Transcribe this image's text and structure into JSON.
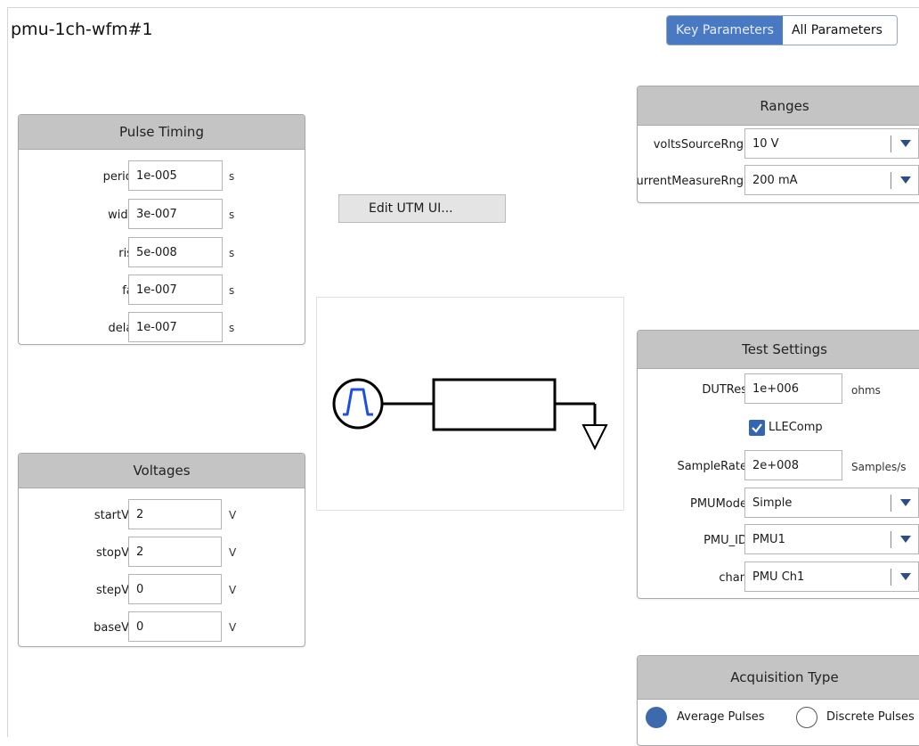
{
  "window_title": "pmu-1ch-wfm#1",
  "view_toggle": {
    "key_parameters": "Key Parameters",
    "all_parameters": "All Parameters",
    "selected": "Key Parameters"
  },
  "edit_button": "Edit UTM UI...",
  "pulse_timing": {
    "title": "Pulse Timing",
    "rows": [
      {
        "label": "period",
        "value": "1e-005",
        "unit": "s"
      },
      {
        "label": "width",
        "value": "3e-007",
        "unit": "s"
      },
      {
        "label": "rise",
        "value": "5e-008",
        "unit": "s"
      },
      {
        "label": "fall",
        "value": "1e-007",
        "unit": "s"
      },
      {
        "label": "delay",
        "value": "1e-007",
        "unit": "s"
      }
    ]
  },
  "voltages": {
    "title": "Voltages",
    "rows": [
      {
        "label": "startV",
        "value": "2",
        "unit": "V"
      },
      {
        "label": "stopV",
        "value": "2",
        "unit": "V"
      },
      {
        "label": "stepV",
        "value": "0",
        "unit": "V"
      },
      {
        "label": "baseV",
        "value": "0",
        "unit": "V"
      }
    ]
  },
  "ranges": {
    "title": "Ranges",
    "volts_label": "voltsSourceRng",
    "volts_value": "10 V",
    "current_label": "urrentMeasureRng",
    "current_value": "200 mA"
  },
  "test_settings": {
    "title": "Test Settings",
    "dutres_label": "DUTRes",
    "dutres_value": "1e+006",
    "dutres_unit": "ohms",
    "llecomp_label": "LLEComp",
    "llecomp_checked": true,
    "samplerate_label": "SampleRate",
    "samplerate_value": "2e+008",
    "samplerate_unit": "Samples/s",
    "pmumode_label": "PMUMode",
    "pmumode_value": "Simple",
    "pmuid_label": "PMU_ID",
    "pmuid_value": "PMU1",
    "chan_label": "chan",
    "chan_value": "PMU Ch1"
  },
  "acquisition": {
    "title": "Acquisition Type",
    "option_average": "Average Pulses",
    "option_discrete": "Discrete Pulses",
    "selected": "Average Pulses"
  },
  "colors": {
    "accent": "#4a79c4",
    "pulse": "#1f4fe0",
    "header": "#c4c4c4"
  }
}
